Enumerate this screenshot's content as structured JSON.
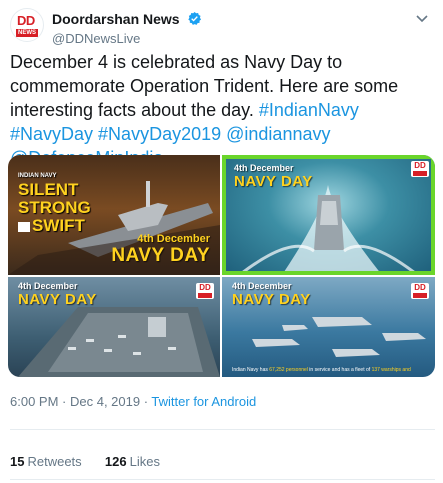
{
  "account": {
    "display_name": "Doordarshan News",
    "handle": "@DDNewsLive",
    "avatar_text": "DD",
    "avatar_sub": "NEWS"
  },
  "tweet": {
    "text_lead": "December 4 is celebrated as Navy Day to commemorate Operation Trident. Here are some interesting facts about the day. ",
    "hashtag1": "#IndianNavy",
    "hashtag2": "#NavyDay",
    "hashtag3": "#NavyDay2019",
    "mention1": "@indiannavy",
    "mention2": "@DefenceMinIndia"
  },
  "media": {
    "tile1": {
      "kicker": "INDIAN NAVY",
      "slogan1": "SILENT",
      "slogan2": "STRONG",
      "slogan3": "SWIFT",
      "date": "4th December",
      "title": "NAVY DAY"
    },
    "tile2": {
      "date": "4th December",
      "title": "NAVY DAY",
      "badge": "DD"
    },
    "tile3": {
      "date": "4th December",
      "title": "NAVY DAY",
      "badge": "DD"
    },
    "tile4": {
      "date": "4th December",
      "title": "NAVY DAY",
      "badge": "DD",
      "caption_a": "Indian Navy has ",
      "caption_b": "67,252 personnel",
      "caption_c": " in service and has a fleet of ",
      "caption_d": "137 warships and"
    }
  },
  "meta": {
    "time": "6:00 PM",
    "sep": " · ",
    "date": "Dec 4, 2019",
    "sep2": " · ",
    "source": "Twitter for Android"
  },
  "stats": {
    "retweets_count": "15",
    "retweets_label": "Retweets",
    "likes_count": "126",
    "likes_label": "Likes"
  },
  "colors": {
    "link": "#1b95e0",
    "highlight": "#6ad52b",
    "brand_red": "#d71f26"
  }
}
